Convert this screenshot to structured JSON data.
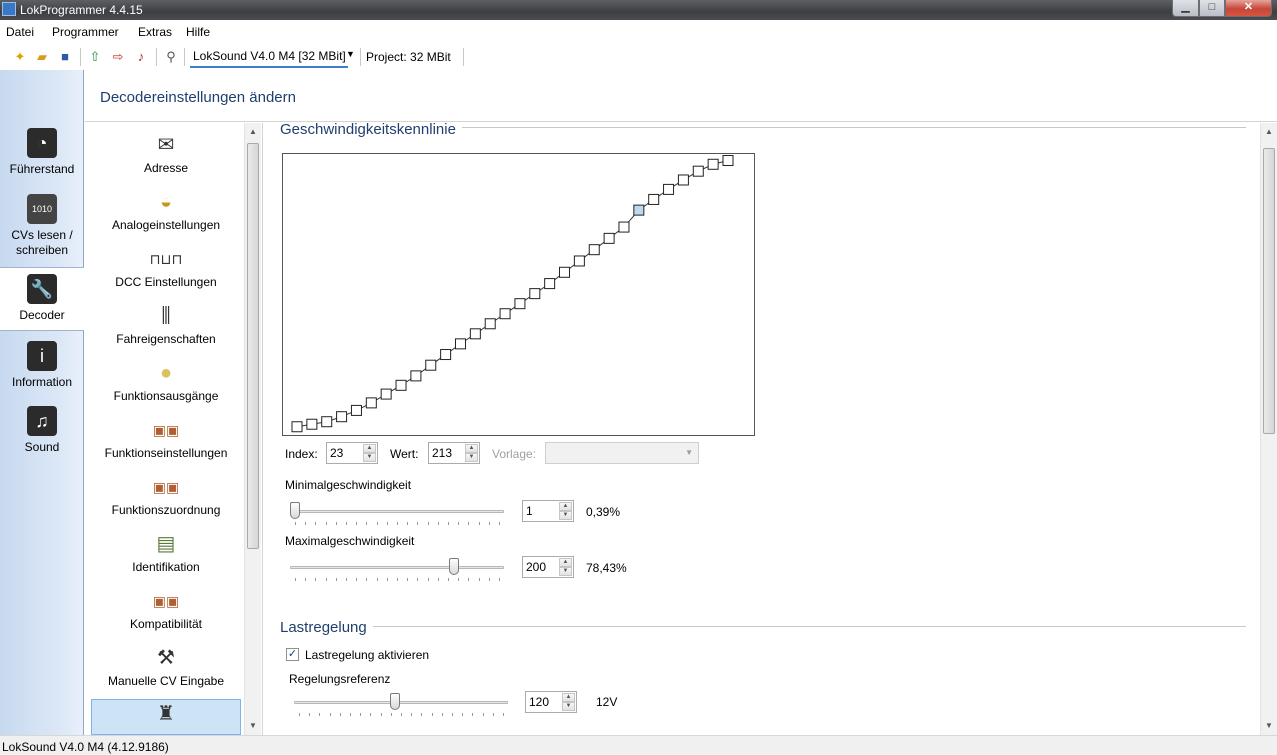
{
  "window": {
    "title": "LokProgrammer 4.4.15",
    "minimize": "▁",
    "maximize": "□",
    "close": "✕"
  },
  "menu": [
    "Datei",
    "Programmer",
    "Extras",
    "Hilfe"
  ],
  "toolbar": {
    "icons": [
      "new-file-icon",
      "open-folder-icon",
      "save-icon",
      "upload-icon",
      "download-icon",
      "sound-play-icon",
      "tool-icon"
    ],
    "decoder": "LokSound V4.0 M4 [32 MBit]",
    "project": "Project:  32 MBit"
  },
  "leftnav": [
    {
      "label": "Führerstand",
      "icon": "cab-icon"
    },
    {
      "label": "CVs lesen / schreiben",
      "icon": "binary-cv-icon"
    },
    {
      "label": "Decoder",
      "icon": "wrench-icon",
      "selected": true
    },
    {
      "label": "Information",
      "icon": "info-icon"
    },
    {
      "label": "Sound",
      "icon": "music-note-icon"
    }
  ],
  "header": {
    "title": "Decodereinstellungen ändern"
  },
  "categories": [
    {
      "label": "Adresse",
      "icon": "envelope-icon"
    },
    {
      "label": "Analogeinstellungen",
      "icon": "analog-gauge-icon"
    },
    {
      "label": "DCC Einstellungen",
      "icon": "dcc-signal-icon"
    },
    {
      "label": "Fahreigenschaften",
      "icon": "sliders-icon"
    },
    {
      "label": "Funktionsausgänge",
      "icon": "light-bulb-icon"
    },
    {
      "label": "Funktionseinstellungen",
      "icon": "function-keys-icon"
    },
    {
      "label": "Funktionszuordnung",
      "icon": "function-keys-icon"
    },
    {
      "label": "Identifikation",
      "icon": "id-card-icon"
    },
    {
      "label": "Kompatibilität",
      "icon": "function-keys-icon"
    },
    {
      "label": "Manuelle CV Eingabe",
      "icon": "wrench-cv-icon"
    },
    {
      "label": "",
      "icon": "horn-icon",
      "selected": true
    }
  ],
  "speed_curve": {
    "title": "Geschwindigkeitskennlinie",
    "selected_index": 23,
    "values": [
      2,
      6,
      10,
      18,
      28,
      40,
      54,
      68,
      83,
      100,
      117,
      134,
      150,
      166,
      182,
      198,
      214,
      230,
      248,
      266,
      284,
      302,
      320,
      347,
      364,
      380,
      395,
      409,
      420,
      426
    ],
    "index_label": "Index:",
    "index_value": "23",
    "wert_label": "Wert:",
    "wert_value": "213",
    "vorlage_label": "Vorlage:",
    "vorlage_value": ""
  },
  "min_speed": {
    "label": "Minimalgeschwindigkeit",
    "value": "1",
    "percent": "0,39%",
    "fraction": 0.0
  },
  "max_speed": {
    "label": "Maximalgeschwindigkeit",
    "value": "200",
    "percent": "78,43%",
    "fraction": 0.78
  },
  "load_control": {
    "title": "Lastregelung",
    "enable_label": "Lastregelung aktivieren",
    "enabled": true,
    "reference_label": "Regelungsreferenz",
    "reference_value": "120",
    "reference_unit": "12V",
    "fraction": 0.47
  },
  "status": "LokSound V4.0 M4 (4.12.9186)",
  "glyphs": {
    "up": "▲",
    "down": "▼",
    "check": "✓",
    "dropdown": "▼"
  }
}
